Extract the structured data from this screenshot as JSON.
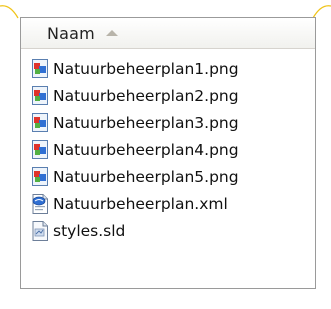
{
  "header": {
    "column_name": "Naam",
    "sort": "ascending"
  },
  "files": [
    {
      "name": "Natuurbeheerplan1.png",
      "icon": "png-image-icon"
    },
    {
      "name": "Natuurbeheerplan2.png",
      "icon": "png-image-icon"
    },
    {
      "name": "Natuurbeheerplan3.png",
      "icon": "png-image-icon"
    },
    {
      "name": "Natuurbeheerplan4.png",
      "icon": "png-image-icon"
    },
    {
      "name": "Natuurbeheerplan5.png",
      "icon": "png-image-icon"
    },
    {
      "name": "Natuurbeheerplan.xml",
      "icon": "xml-file-icon"
    },
    {
      "name": "styles.sld",
      "icon": "generic-file-icon"
    }
  ],
  "colors": {
    "accent_arc": "#f0c419",
    "border": "#9a9a9a",
    "header_sort_arrow": "#b8b4aa"
  }
}
